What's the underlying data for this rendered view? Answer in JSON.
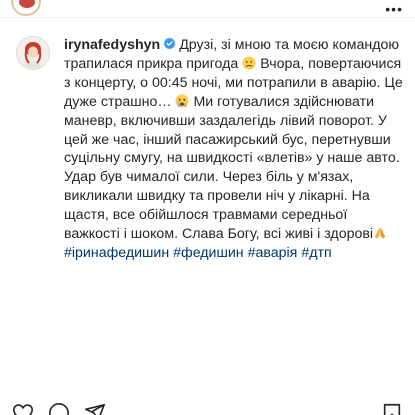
{
  "header": {
    "more_label": "•••"
  },
  "post": {
    "username": "irynafedyshyn",
    "verified": true,
    "segments": {
      "p1": "Друзі, зі мною та моєю командою трапилася прикра пригода",
      "p2": "Вчора, повертаючися з концерту, о 00:45 ночі, ми потрапили в аварію. Це дуже страшно…",
      "p3": "Ми готувалися здійснювати маневр, включивши заздалегідь лівий поворот. У цей же час, інший пасажирський бус, перетнувши суцільну смугу, на швидкості «влетів» у наше авто. Удар був чималої сили. Через біль у м'язах, викликали швидку та провели ніч у лікарні. На щастя, все обійшлося травмами середньої важкості і шоком. Слава Богу, всі живі і здорові"
    },
    "emojis": [
      "disappointed-face-emoji",
      "crying-face-emoji",
      "praying-hands-emoji"
    ],
    "hashtags": [
      "#іринафедишин",
      "#федишин",
      "#аварія",
      "#дтп"
    ]
  },
  "actions": {
    "icons": [
      "heart-icon",
      "comment-icon",
      "share-icon",
      "bookmark-icon"
    ]
  },
  "colors": {
    "text": "#262626",
    "hashtag": "#00376b",
    "verified": "#3897f0",
    "divider": "#efefef"
  }
}
